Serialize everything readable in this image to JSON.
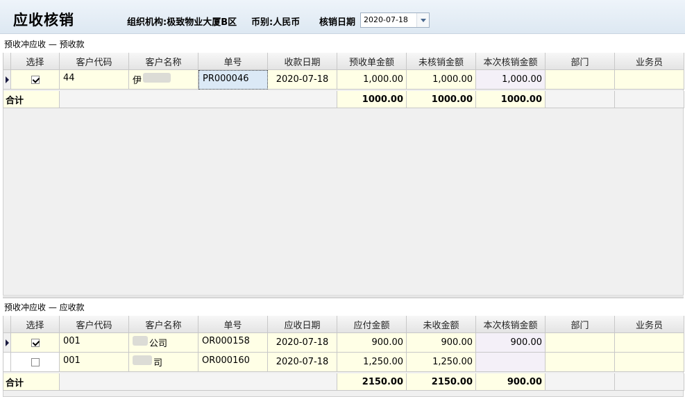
{
  "header": {
    "title": "应收核销",
    "org_label": "组织机构:",
    "org_value": "极致物业大厦B区",
    "currency_label": "币别:",
    "currency_value": "人民币",
    "date_label": "核销日期",
    "date_value": "2020-07-18"
  },
  "section1": {
    "label": "预收冲应收 — 预收款",
    "columns": [
      "选择",
      "客户代码",
      "客户名称",
      "单号",
      "收款日期",
      "预收单金额",
      "未核销金额",
      "本次核销金额",
      "部门",
      "业务员"
    ],
    "rows": [
      {
        "checked": true,
        "code": "44",
        "name": "伊",
        "no": "PR000046",
        "date": "2020-07-18",
        "amount": "1,000.00",
        "unverified": "1,000.00",
        "this": "1,000.00",
        "dept": "",
        "staff": ""
      }
    ],
    "total": {
      "label": "合计",
      "amount": "1000.00",
      "unverified": "1000.00",
      "this": "1000.00"
    }
  },
  "section2": {
    "label": "预收冲应收 — 应收款",
    "columns": [
      "选择",
      "客户代码",
      "客户名称",
      "单号",
      "应收日期",
      "应付金额",
      "未收金额",
      "本次核销金额",
      "部门",
      "业务员"
    ],
    "rows": [
      {
        "checked": true,
        "code": "001",
        "name": "公司",
        "no": "OR000158",
        "date": "2020-07-18",
        "amount": "900.00",
        "unverified": "900.00",
        "this": "900.00",
        "dept": "",
        "staff": ""
      },
      {
        "checked": false,
        "code": "001",
        "name": "司",
        "no": "OR000160",
        "date": "2020-07-18",
        "amount": "1,250.00",
        "unverified": "1,250.00",
        "this": "",
        "dept": "",
        "staff": ""
      }
    ],
    "total": {
      "label": "合计",
      "amount": "2150.00",
      "unverified": "2150.00",
      "this": "900.00"
    }
  }
}
